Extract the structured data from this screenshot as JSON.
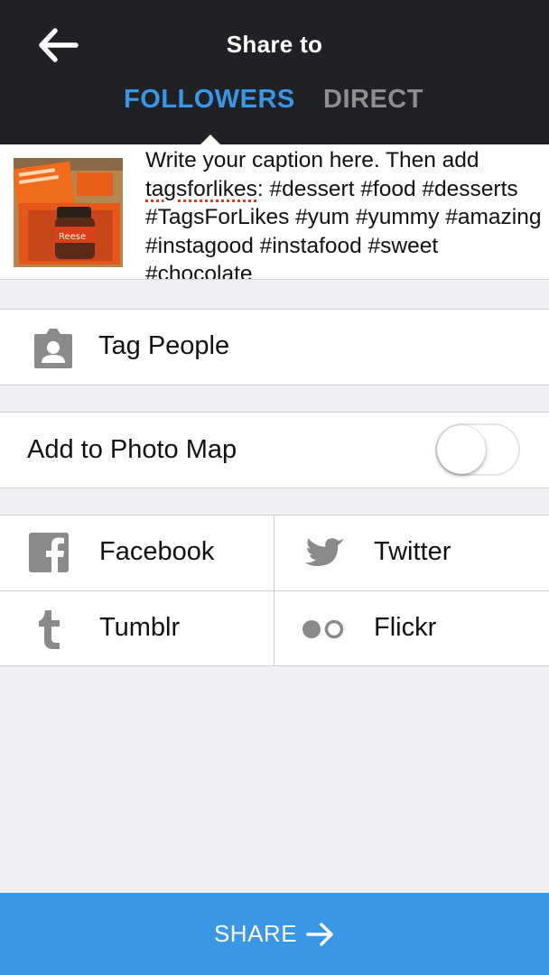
{
  "header": {
    "title": "Share to",
    "back_icon": "back-arrow-icon",
    "tabs": [
      {
        "label": "FOLLOWERS",
        "active": true
      },
      {
        "label": "DIRECT",
        "active": false
      }
    ]
  },
  "caption": {
    "text_before": "Write your caption here. Then add ",
    "misspelled": "tagsforlikes",
    "text_after": ": #dessert #food #desserts #TagsForLikes #yum #yummy #amazing #instagood #instafood #sweet #chocolate"
  },
  "tag_people": {
    "label": "Tag People",
    "icon": "tag-person-icon"
  },
  "photo_map": {
    "label": "Add to Photo Map",
    "enabled": false
  },
  "services": [
    {
      "label": "Facebook",
      "icon": "facebook-icon"
    },
    {
      "label": "Twitter",
      "icon": "twitter-icon"
    },
    {
      "label": "Tumblr",
      "icon": "tumblr-icon"
    },
    {
      "label": "Flickr",
      "icon": "flickr-icon"
    }
  ],
  "share_button": {
    "label": "SHARE",
    "icon": "arrow-right-icon"
  },
  "colors": {
    "header_bg": "#1f2124",
    "accent": "#3a97e6",
    "inactive_tab": "#8e8e91",
    "icon_gray": "#8a8a8c",
    "page_bg": "#efeff4"
  }
}
